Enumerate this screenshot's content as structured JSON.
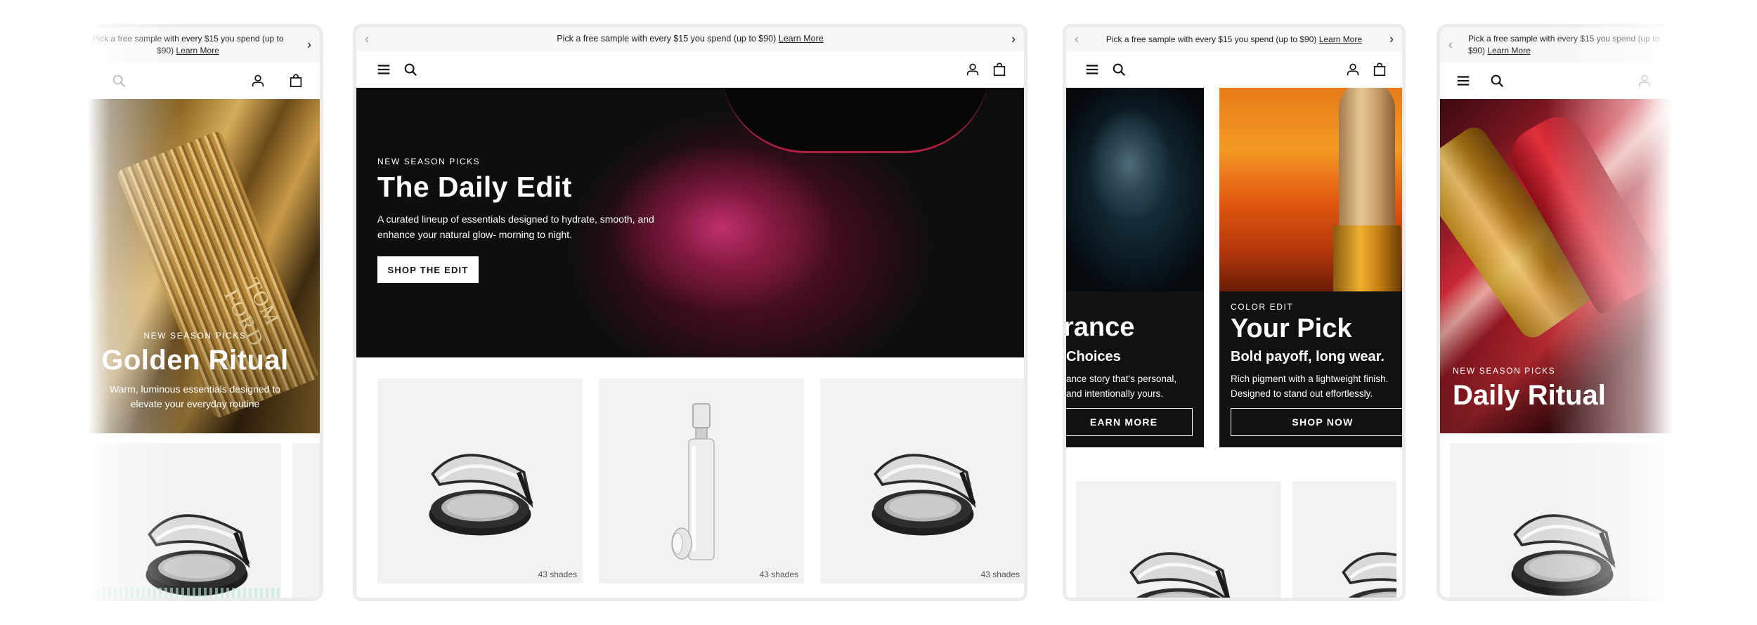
{
  "promo": {
    "text": "Pick a free sample with every $15 you spend (up to $90)",
    "link": "Learn More",
    "text_wrapped_a": "Pick a free sample with every $15 you spend (up to",
    "text_wrapped_b": "$90)"
  },
  "screen1": {
    "hero_eyebrow": "NEW SEASON PICKS",
    "hero_title": "Golden Ritual",
    "hero_desc": "Warm, luminous essentials designed to elevate your everyday routine",
    "bottle_text": "TOM FORD"
  },
  "screen2": {
    "hero_eyebrow": "NEW SEASON PICKS",
    "hero_title": "The Daily Edit",
    "hero_desc": "A curated lineup of essentials designed to hydrate, smooth, and enhance your natural glow- morning to night.",
    "cta": "SHOP THE EDIT",
    "products": [
      {
        "kind": "compact",
        "shades": "43 shades"
      },
      {
        "kind": "bottle",
        "shades": "43 shades"
      },
      {
        "kind": "compact",
        "shades": "43 shades"
      }
    ]
  },
  "screen3": {
    "left_title": "rance",
    "left_subtitle": "Choices",
    "left_desc_a": "ance story that's personal,",
    "left_desc_b": "and intentionally yours.",
    "left_cta": "EARN MORE",
    "right_eyebrow": "COLOR EDIT",
    "right_title": "Your Pick",
    "right_subtitle": "Bold payoff, long wear.",
    "right_desc": "Rich pigment with a lightweight finish. Designed to stand out effortlessly.",
    "right_cta": "SHOP NOW"
  },
  "screen4": {
    "hero_eyebrow": "NEW SEASON PICKS",
    "hero_title": "Daily Ritual"
  },
  "colors": {
    "dark_panel": "#111111",
    "tile_bg": "#f2f2f2",
    "promo_bg": "#f7f7f7",
    "device_border": "#ebebeb"
  },
  "icons": [
    "menu-icon",
    "search-icon",
    "account-icon",
    "bag-icon",
    "chevron-left-icon",
    "chevron-right-icon"
  ]
}
